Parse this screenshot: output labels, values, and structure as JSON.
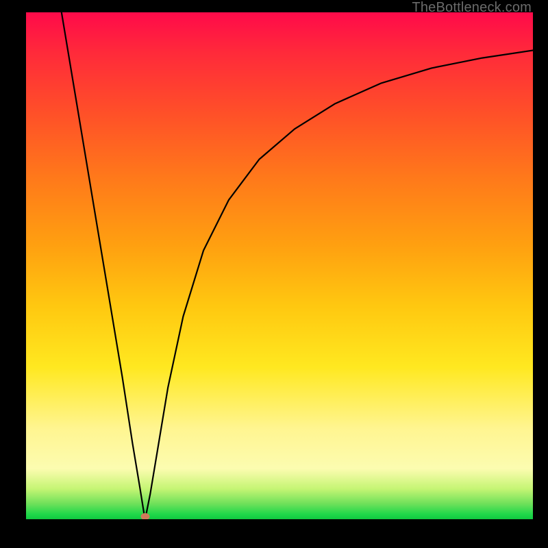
{
  "attribution": "TheBottleneck.com",
  "colors": {
    "frame": "#000000",
    "curve": "#000000",
    "marker": "#cf7a5a",
    "gradient_stops": [
      "#ff0a4a",
      "#ff2a3a",
      "#ff5028",
      "#ff7a1a",
      "#ffa010",
      "#ffc810",
      "#ffe820",
      "#fff590",
      "#fcfcb0",
      "#c5f574",
      "#6de05a",
      "#20d84a",
      "#10c840"
    ]
  },
  "chart_data": {
    "type": "line",
    "title": "",
    "xlabel": "",
    "ylabel": "",
    "xlim": [
      0,
      100
    ],
    "ylim": [
      0,
      100
    ],
    "grid": false,
    "legend": false,
    "series": [
      {
        "name": "curve",
        "x": [
          7,
          10,
          13,
          16,
          19,
          21,
          22.5,
          23.3,
          23.7,
          24.5,
          26,
          28,
          31,
          35,
          40,
          46,
          53,
          61,
          70,
          80,
          90,
          100
        ],
        "y": [
          100,
          82,
          64,
          46,
          28,
          15,
          6,
          1,
          1,
          5,
          14,
          26,
          40,
          53,
          63,
          71,
          77,
          82,
          86,
          89,
          91,
          92.5
        ]
      }
    ],
    "marker": {
      "x": 23.5,
      "y": 0,
      "shape": "ellipse"
    },
    "note": "y represents height from bottom (0=bottom, 100=top). The curve is a sharp V with minimum near x≈23.5 at the bottom, rising asymptotically on the right."
  }
}
